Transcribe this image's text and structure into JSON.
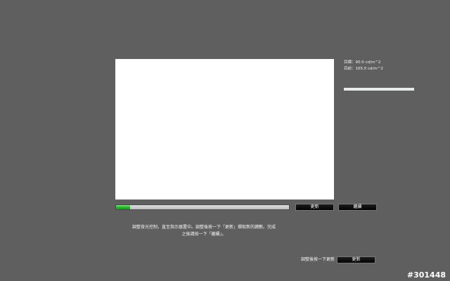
{
  "readout": {
    "target": "目標：90.0 cd/m^2",
    "current": "目前：165.0 cd/m^2"
  },
  "level_bar": {
    "fill_fraction": 1.0,
    "color": "#e4eaea"
  },
  "progress": {
    "fraction": 0.08,
    "color": "#25b128"
  },
  "buttons": {
    "refresh_top": "更新",
    "continue": "繼續",
    "refresh_bottom": "更新"
  },
  "instructions": {
    "line1": "調整背光控制，直至指示器置中。調整後按一下「更新」擷取新的讀數。完成",
    "line2": "之後請按一下「繼續」。"
  },
  "refresh_hint": "調整後按一下更新",
  "watermark": "#301448"
}
